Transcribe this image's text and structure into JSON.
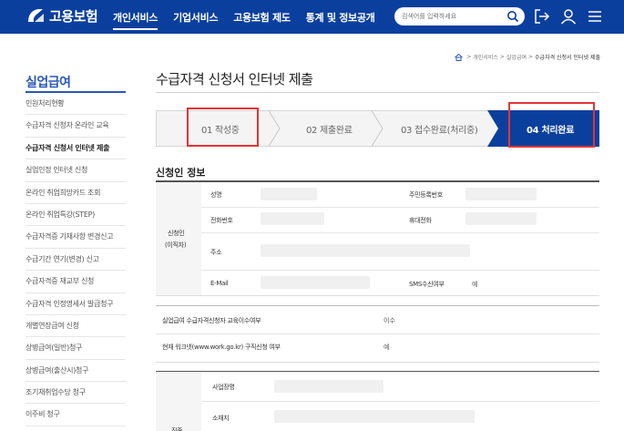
{
  "header": {
    "logo_text": "고용보험",
    "nav": [
      "개인서비스",
      "기업서비스",
      "고용보험 제도",
      "통계 및 정보공개"
    ],
    "search_placeholder": "검색어를 입력하세요"
  },
  "breadcrumb": [
    "개인서비스",
    "실업급여",
    "수급자격 신청서 인터넷 제출"
  ],
  "sidebar": {
    "title": "실업급여",
    "items": [
      "민원처리현황",
      "수급자격 신청자 온라인 교육",
      "수급자격 신청서 인터넷 제출",
      "실업인정 인터넷 신청",
      "온라인 취업희망카드 조회",
      "온라인 취업특강(STEP)",
      "수급자격증 기재사항 변경신고",
      "수급기간 연기(변경) 신고",
      "수급자격증 재교부 신청",
      "수급자격 인정명세서 발급청구",
      "개별연장급여 신청",
      "상병급여(일반)청구",
      "상병급여(출산시)청구",
      "조기재취업수당 청구",
      "이주비 청구"
    ]
  },
  "main": {
    "title": "수급자격 신청서 인터넷 제출",
    "steps": [
      "01 작성중",
      "02 제출완료",
      "03 접수완료(처리중)",
      "04 처리완료"
    ],
    "section_title": "신청인 정보",
    "applicant_header": [
      "신청인",
      "(이직자)"
    ],
    "fields": {
      "name": "성명",
      "resident_no": "주민등록번호",
      "phone": "전화번호",
      "mobile": "휴대전화",
      "address": "주소",
      "email": "E-Mail",
      "sms": "SMS수신여부",
      "sms_value": "예"
    },
    "edu": {
      "label": "실업급여 수급자격신청자 교육이수여부",
      "value": "이수"
    },
    "worknet": {
      "label": "현재 워크넷(www.work.go.kr) 구직신청 여부",
      "value": "예"
    },
    "employer": {
      "section_label": "직종",
      "business_name": "사업장명",
      "location": "소재지"
    }
  },
  "colors": {
    "header_bg": "#0a3f9e",
    "active_step": "#0a3f9e",
    "highlight_border": "#e53434",
    "sidebar_title": "#2a58b8"
  }
}
